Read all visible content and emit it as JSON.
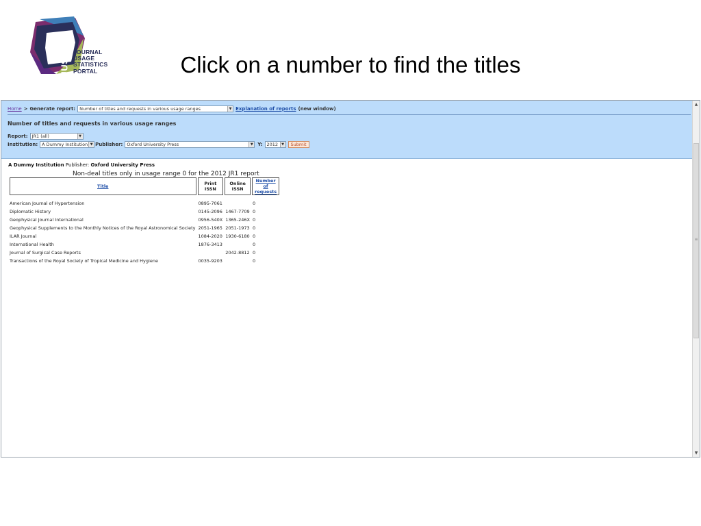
{
  "logo": {
    "vertical": "JUSP",
    "lines": [
      "JOURNAL",
      "USAGE",
      "STATISTICS",
      "PORTAL"
    ]
  },
  "slide_title": "Click on a number to find the titles",
  "browser": {
    "breadcrumb": {
      "home": "Home",
      "separator": ">",
      "generate_label": "Generate report:"
    },
    "report_type_select": "Number of titles and requests in various usage ranges",
    "explanation_link": "Explanation of reports",
    "new_window": "(new window)",
    "heading": "Number of titles and requests in various usage ranges",
    "report_label": "Report:",
    "report_select": "JR1 (all)",
    "institution_label": "Institution:",
    "institution_select": "A Dummy Institution",
    "publisher_label": "Publisher:",
    "publisher_select": "Oxford University Press",
    "year_label": "Y:",
    "year_select": "2012",
    "submit": "Submit"
  },
  "results": {
    "institution": "A Dummy Institution",
    "publisher_label": "Publisher:",
    "publisher": "Oxford University Press",
    "caption": "Non-deal titles only in usage range 0 for the 2012 JR1 report",
    "headers": {
      "title": "Title",
      "print_issn": "Print ISSN",
      "online_issn": "Online ISSN",
      "requests": "Number of requests"
    },
    "rows": [
      {
        "title": "American Journal of Hypertension",
        "print": "0895-7061",
        "online": "",
        "requests": "0"
      },
      {
        "title": "Diplomatic History",
        "print": "0145-2096",
        "online": "1467-7709",
        "requests": "0"
      },
      {
        "title": "Geophysical Journal International",
        "print": "0956-540X",
        "online": "1365-246X",
        "requests": "0"
      },
      {
        "title": "Geophysical Supplements to the Monthly Notices of the Royal Astronomical Society",
        "print": "2051-1965",
        "online": "2051-1973",
        "requests": "0"
      },
      {
        "title": "ILAR Journal",
        "print": "1084-2020",
        "online": "1930-6180",
        "requests": "0"
      },
      {
        "title": "International Health",
        "print": "1876-3413",
        "online": "",
        "requests": "0"
      },
      {
        "title": "Journal of Surgical Case Reports",
        "print": "",
        "online": "2042-8812",
        "requests": "0"
      },
      {
        "title": "Transactions of the Royal Society of Tropical Medicine and Hygiene",
        "print": "0035-9203",
        "online": "",
        "requests": "0"
      }
    ]
  },
  "colors": {
    "panel_bg": "#bcdcfb",
    "link": "#1f4fa8",
    "logo_navy": "#2a2f5a"
  }
}
